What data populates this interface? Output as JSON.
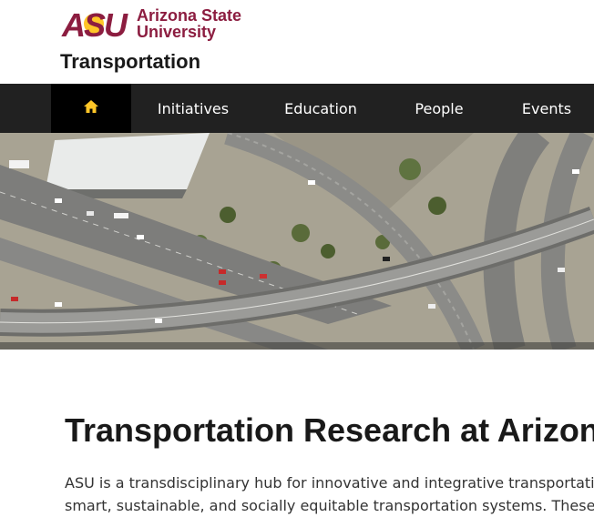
{
  "brand": {
    "logo_letters": "ASU",
    "logo_line1": "Arizona State",
    "logo_line2": "University",
    "maroon": "#8c1d40",
    "gold": "#ffc627"
  },
  "unit_title": "Transportation",
  "nav": {
    "home_icon": "home-icon",
    "items": [
      "Initiatives",
      "Education",
      "People",
      "Events"
    ]
  },
  "hero": {
    "image": "aerial-freeway-interchange"
  },
  "main": {
    "title": "Transportation Research at Arizona",
    "intro_line1": "ASU is a transdisciplinary hub for innovative and integrative transportation",
    "intro_line2": "smart, sustainable, and socially equitable transportation systems. These s"
  }
}
